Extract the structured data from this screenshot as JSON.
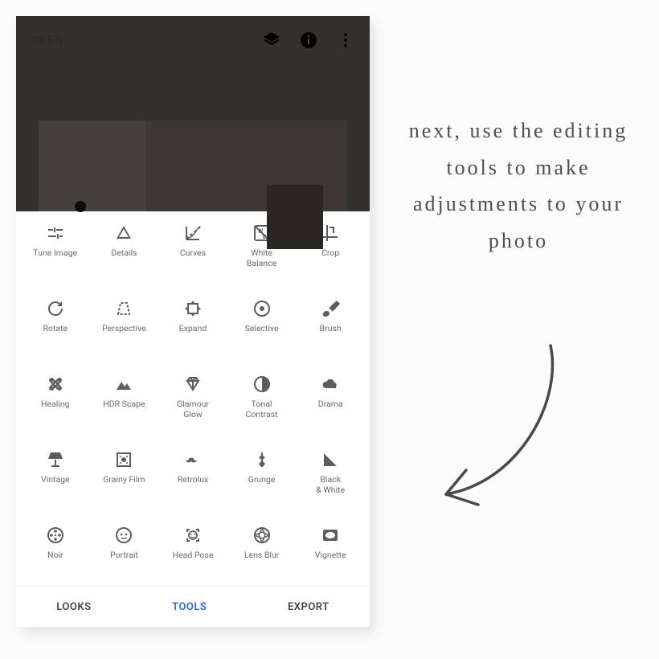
{
  "topbar": {
    "open": "OPEN"
  },
  "tabs": {
    "looks": "LOOKS",
    "tools": "TOOLS",
    "export": "EXPORT"
  },
  "caption": "next, use the\nediting tools\nto make\nadjustments\nto your photo",
  "tools": {
    "tune": "Tune Image",
    "details": "Details",
    "curves": "Curves",
    "wb": "White\nBalance",
    "crop": "Crop",
    "rotate": "Rotate",
    "perspective": "Perspective",
    "expand": "Expand",
    "selective": "Selective",
    "brush": "Brush",
    "healing": "Healing",
    "hdr": "HDR Scape",
    "glamour": "Glamour\nGlow",
    "tonal": "Tonal\nContrast",
    "drama": "Drama",
    "vintage": "Vintage",
    "grainy": "Grainy Film",
    "retrolux": "Retrolux",
    "grunge": "Grunge",
    "bw": "Black\n& White",
    "noir": "Noir",
    "portrait": "Portrait",
    "headpose": "Head Pose",
    "lensblur": "Lens Blur",
    "vignette": "Vignette"
  }
}
